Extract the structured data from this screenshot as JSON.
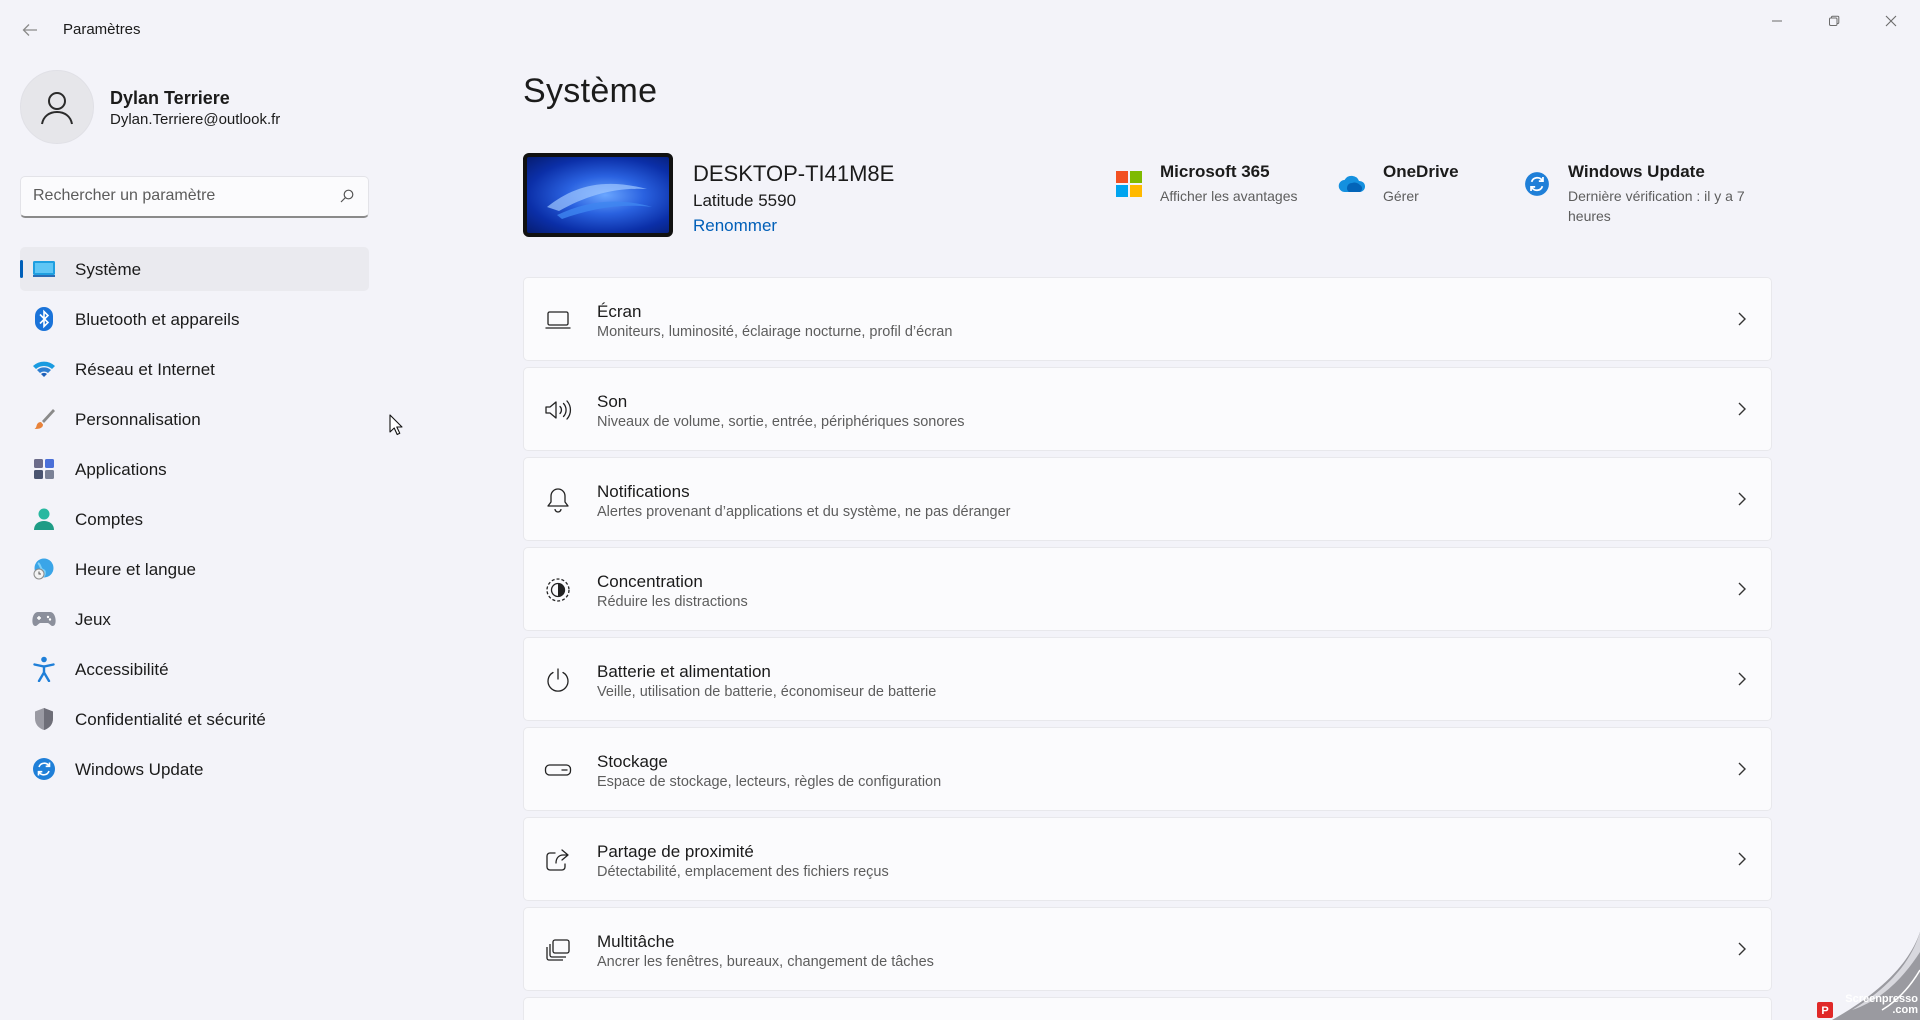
{
  "window": {
    "title": "Paramètres"
  },
  "user": {
    "name": "Dylan Terriere",
    "email": "Dylan.Terriere@outlook.fr"
  },
  "search": {
    "placeholder": "Rechercher un paramètre"
  },
  "sidebar": {
    "items": [
      {
        "label": "Système",
        "icon": "system-icon",
        "active": true
      },
      {
        "label": "Bluetooth et appareils",
        "icon": "bluetooth-icon"
      },
      {
        "label": "Réseau et Internet",
        "icon": "wifi-icon"
      },
      {
        "label": "Personnalisation",
        "icon": "brush-icon"
      },
      {
        "label": "Applications",
        "icon": "apps-icon"
      },
      {
        "label": "Comptes",
        "icon": "account-icon"
      },
      {
        "label": "Heure et langue",
        "icon": "globe-clock-icon"
      },
      {
        "label": "Jeux",
        "icon": "gamepad-icon"
      },
      {
        "label": "Accessibilité",
        "icon": "accessibility-icon"
      },
      {
        "label": "Confidentialité et sécurité",
        "icon": "shield-icon"
      },
      {
        "label": "Windows Update",
        "icon": "update-icon"
      }
    ]
  },
  "main": {
    "title": "Système",
    "device": {
      "name": "DESKTOP-TI41M8E",
      "model": "Latitude 5590",
      "rename_label": "Renommer"
    },
    "quick_links": [
      {
        "title": "Microsoft 365",
        "subtitle": "Afficher les avantages",
        "icon": "microsoft-logo-icon"
      },
      {
        "title": "OneDrive",
        "subtitle": "Gérer",
        "icon": "onedrive-cloud-icon"
      },
      {
        "title": "Windows Update",
        "subtitle": "Dernière vérification : il y a 7 heures",
        "icon": "update-icon"
      }
    ],
    "cards": [
      {
        "title": "Écran",
        "subtitle": "Moniteurs, luminosité, éclairage nocturne, profil d’écran",
        "icon": "laptop-icon"
      },
      {
        "title": "Son",
        "subtitle": "Niveaux de volume, sortie, entrée, périphériques sonores",
        "icon": "speaker-icon"
      },
      {
        "title": "Notifications",
        "subtitle": "Alertes provenant d’applications et du système, ne pas déranger",
        "icon": "bell-icon"
      },
      {
        "title": "Concentration",
        "subtitle": "Réduire les distractions",
        "icon": "focus-icon"
      },
      {
        "title": "Batterie et alimentation",
        "subtitle": "Veille, utilisation de batterie, économiseur de batterie",
        "icon": "power-icon"
      },
      {
        "title": "Stockage",
        "subtitle": "Espace de stockage, lecteurs, règles de configuration",
        "icon": "storage-icon"
      },
      {
        "title": "Partage de proximité",
        "subtitle": "Détectabilité, emplacement des fichiers reçus",
        "icon": "share-icon"
      },
      {
        "title": "Multitâche",
        "subtitle": "Ancrer les fenêtres, bureaux, changement de tâches",
        "icon": "multitask-icon"
      }
    ]
  },
  "watermark": {
    "text": "Screenpresso .com"
  },
  "colors": {
    "accent": "#005fb8",
    "background": "#f3f3f9",
    "card": "#fbfbfd"
  }
}
